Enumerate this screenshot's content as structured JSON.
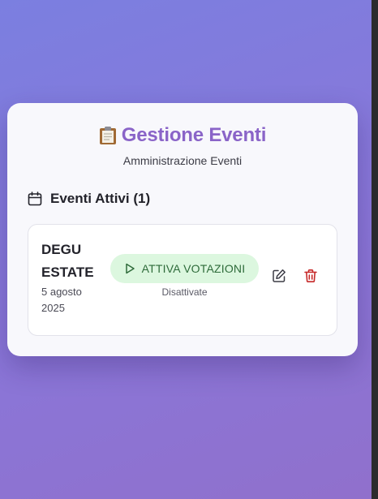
{
  "header": {
    "title": "Gestione Eventi",
    "subtitle": "Amministrazione Eventi",
    "icon": "clipboard-icon"
  },
  "section": {
    "title": "Eventi Attivi (1)",
    "icon": "calendar-icon"
  },
  "events": [
    {
      "name": "DEGU ESTATE",
      "date": "5 agosto 2025",
      "activate_label": "ATTIVA VOTAZIONI",
      "status": "Disattivate"
    }
  ],
  "colors": {
    "title": "#8a64c8",
    "activate_bg": "#dcf7df",
    "activate_text": "#2e6b3a",
    "delete": "#c62828"
  }
}
